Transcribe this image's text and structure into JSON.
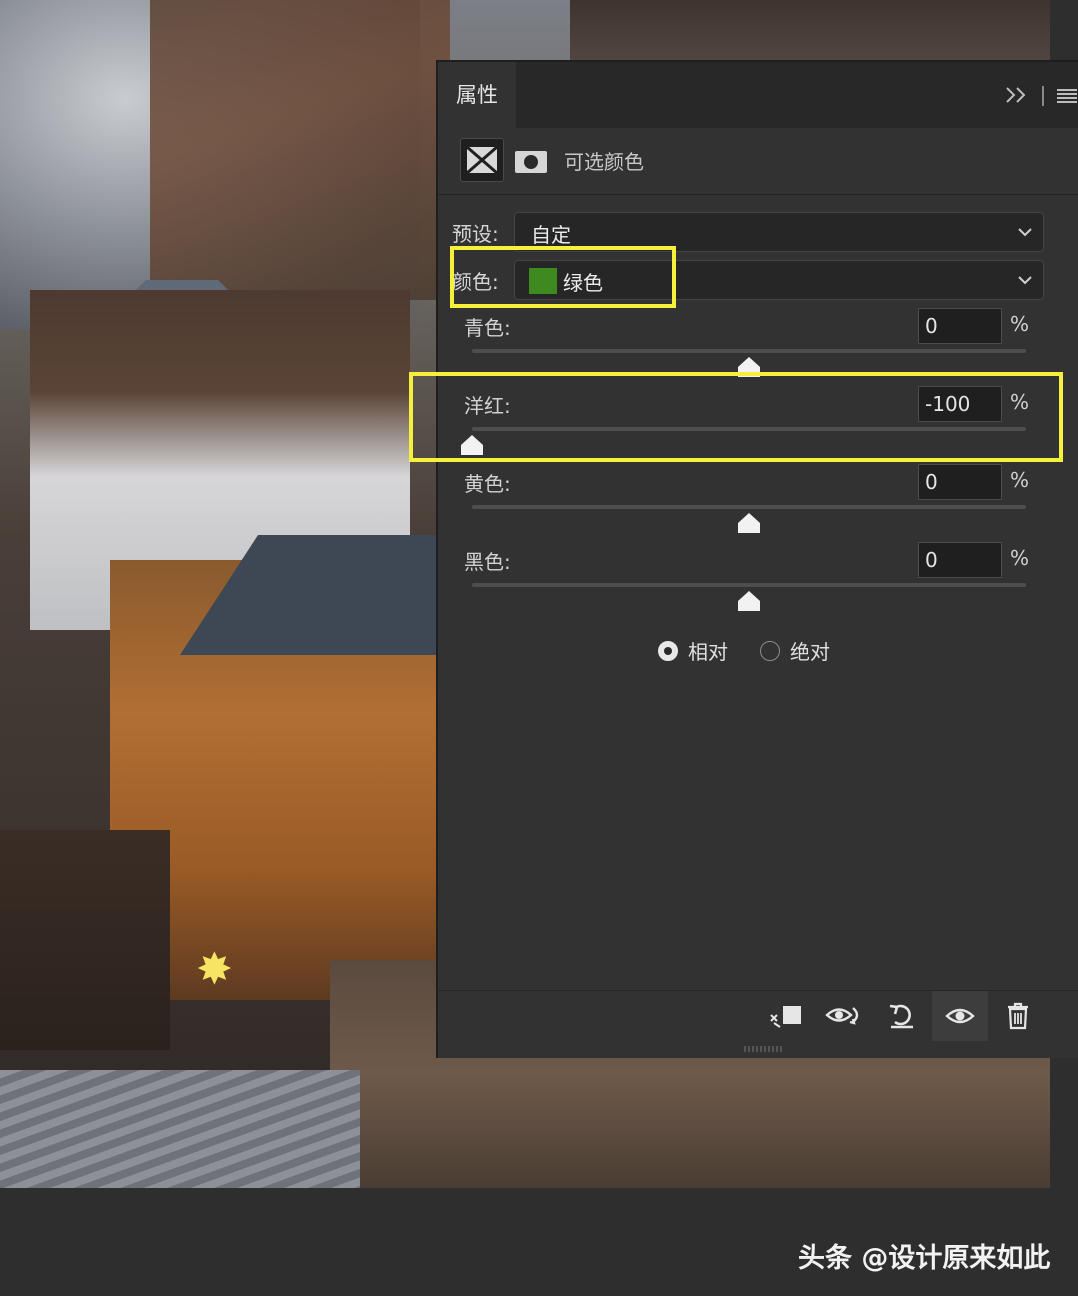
{
  "panel": {
    "tab": "属性",
    "adjustment_title": "可选颜色",
    "preset": {
      "label": "预设:",
      "value": "自定"
    },
    "colors": {
      "label": "颜色:",
      "value": "绿色",
      "swatch_color": "#3e8a1e"
    },
    "sliders": [
      {
        "label": "青色:",
        "value": "0",
        "unit": "%",
        "percent": 0
      },
      {
        "label": "洋红:",
        "value": "-100",
        "unit": "%",
        "percent": -100
      },
      {
        "label": "黄色:",
        "value": "0",
        "unit": "%",
        "percent": 0
      },
      {
        "label": "黑色:",
        "value": "0",
        "unit": "%",
        "percent": 0
      }
    ],
    "method": {
      "relative": {
        "label": "相对",
        "checked": true
      },
      "absolute": {
        "label": "绝对",
        "checked": false
      }
    },
    "footer_icons": [
      "clip-to-layer-icon",
      "view-previous-state-icon",
      "reset-icon",
      "visibility-icon",
      "trash-icon"
    ]
  },
  "highlight_color": "#f5f13a",
  "watermark": "头条 @设计原来如此"
}
